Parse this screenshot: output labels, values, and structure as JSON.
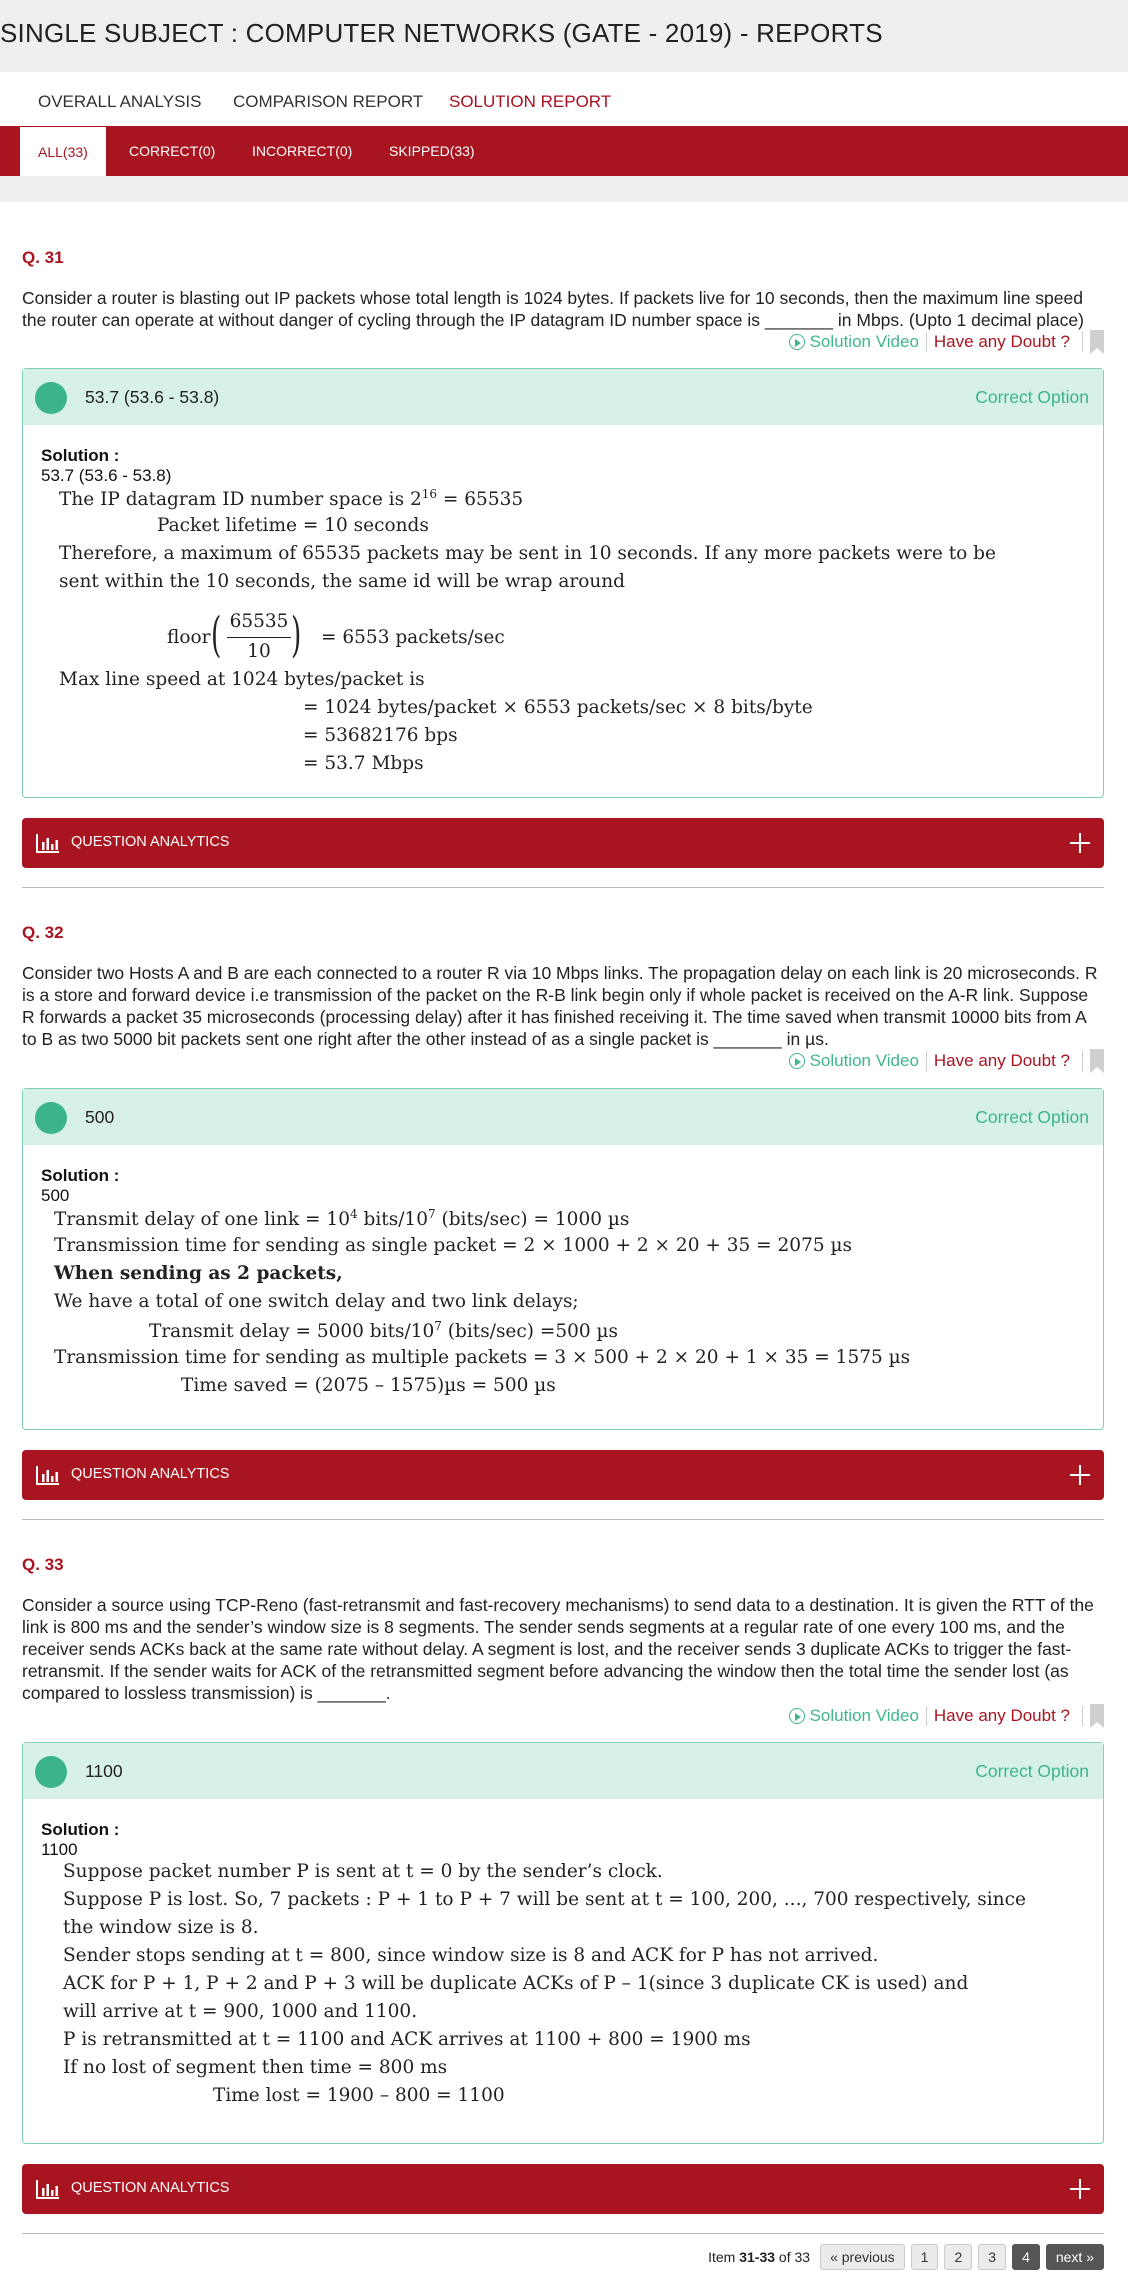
{
  "page_title": "SINGLE SUBJECT : COMPUTER NETWORKS (GATE - 2019) - REPORTS",
  "top_tabs": [
    "OVERALL ANALYSIS",
    "COMPARISON REPORT",
    "SOLUTION REPORT"
  ],
  "filter_tabs": [
    "ALL(33)",
    "CORRECT(0)",
    "INCORRECT(0)",
    "SKIPPED(33)"
  ],
  "common": {
    "solution_video": "Solution Video",
    "doubt": "Have any Doubt ?",
    "correct_option": "Correct Option",
    "solution_label": "Solution :",
    "analytics": "QUESTION ANALYTICS"
  },
  "colors": {
    "accent": "#a8141f",
    "green": "#3cb48b",
    "green_bg": "#d7f1e7"
  },
  "questions": [
    {
      "number": "Q. 31",
      "text": "Consider a router is blasting out IP packets whose total length is 1024 bytes. If packets live for 10 seconds, then the maximum line speed the router can operate at without danger of cycling through the IP datagram ID number space is _______ in Mbps. (Upto 1 decimal place)",
      "answer": "53.7 (53.6 - 53.8)",
      "solution": {
        "l1_a": "The IP datagram ID number space is 2",
        "l1_sup": "16",
        "l1_b": " = 65535",
        "l2": "Packet lifetime  =  10 seconds",
        "l3": "Therefore, a maximum of 65535 packets may be sent in 10 seconds. If any more packets were to be",
        "l4": "sent within the 10 seconds, the same id will be wrap around",
        "floor": "floor",
        "num": "65535",
        "den": "10",
        "floor_result": "=  6553 packets/sec",
        "l5": "Max line speed at 1024 bytes/packet is",
        "l6": "=  1024 bytes/packet × 6553 packets/sec × 8 bits/byte",
        "l7": "=  53682176 bps",
        "l8": "=  53.7 Mbps"
      }
    },
    {
      "number": "Q. 32",
      "text": "Consider two Hosts A and B are each connected to a router R via 10 Mbps links. The propagation delay on each link is 20 microseconds. R is a store and forward device i.e transmission of the packet on the R-B link begin only if whole packet is received on the A-R link. Suppose R forwards a packet 35 microseconds (processing delay) after it has finished receiving it. The time saved when transmit 10000 bits from A to B as two 5000 bit packets sent one right after the other instead of as a single packet is _______ in µs.",
      "answer": "500",
      "solution": {
        "l1_a": "Transmit delay of one link = 10",
        "l1_sup1": "4",
        "l1_b": " bits/10",
        "l1_sup2": "7",
        "l1_c": " (bits/sec) = 1000 µs",
        "l2": "Transmission time for sending as single packet = 2 × 1000 + 2 × 20 + 35 = 2075 µs",
        "l3": "When sending as 2 packets,",
        "l4": "We have a total of one switch delay and two link delays;",
        "l5_a": "Transmit delay  =  5000 bits/10",
        "l5_sup": "7",
        "l5_b": " (bits/sec) =500 µs",
        "l6": "Transmission time for sending as multiple packets = 3 × 500 + 2 × 20 + 1 × 35 = 1575 µs",
        "l7": "Time saved  =  (2075 – 1575)µs  = 500 µs"
      }
    },
    {
      "number": "Q. 33",
      "text": "Consider a source using TCP-Reno (fast-retransmit and fast-recovery mechanisms) to send data to a destination. It is given the RTT of the link is 800 ms and the sender’s window size is 8 segments. The sender sends segments at a regular rate of one every 100 ms, and the receiver sends ACKs back at the same rate without delay. A segment is lost, and the receiver sends 3 duplicate ACKs to trigger the fast-retransmit. If the sender waits for ACK of the retransmitted segment before advancing the window then the total time the sender lost (as compared to lossless transmission) is _______.",
      "answer": "1100",
      "solution": {
        "l1": "Suppose packet number P is sent at t = 0 by the sender’s clock.",
        "l2": "Suppose P is lost. So, 7 packets : P + 1 to P + 7 will be sent at t = 100, 200, ..., 700 respectively, since",
        "l3": "the window size is 8.",
        "l4": "Sender stops sending at t = 800, since window size is 8 and ACK for P has not arrived.",
        "l5": "ACK for P + 1, P + 2 and P + 3 will be duplicate ACKs of P – 1(since 3 duplicate CK is used) and",
        "l6": "will arrive at t = 900, 1000 and 1100.",
        "l7": "P is retransmitted at t = 1100 and ACK arrives at 1100 + 800 = 1900 ms",
        "l8": "If no lost of segment then time = 800 ms",
        "l9": "Time lost  =  1900 – 800 = 1100"
      }
    }
  ],
  "pagination": {
    "prefix": "Item ",
    "range": "31-33",
    "suffix": " of 33",
    "previous": "« previous",
    "pages": [
      "1",
      "2",
      "3",
      "4"
    ],
    "next": "next »"
  }
}
